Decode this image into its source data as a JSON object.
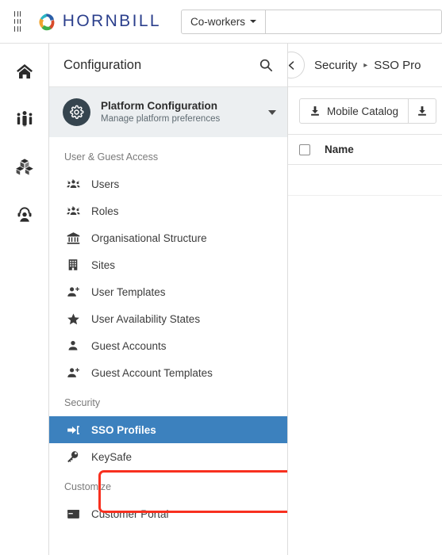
{
  "topbar": {
    "apps_icon": "apps-grid-icon",
    "brand_name": "HORNBILL",
    "brand_logo_icon": "hornbill-pinwheel-logo",
    "search_scope_label": "Co-workers",
    "search_placeholder": "",
    "search_value": "",
    "caret_icon": "caret-down-icon"
  },
  "rail": {
    "items": [
      {
        "icon": "home-icon",
        "name": "home"
      },
      {
        "icon": "people-group-icon",
        "name": "collaboration"
      },
      {
        "icon": "boxes-icon",
        "name": "applications"
      },
      {
        "icon": "service-agent-icon",
        "name": "service-manager"
      }
    ]
  },
  "config_panel": {
    "title": "Configuration",
    "search_icon": "search-icon",
    "context": {
      "icon": "gear-icon",
      "title": "Platform Configuration",
      "subtitle": "Manage platform preferences",
      "caret_icon": "caret-down-icon"
    },
    "groups": [
      {
        "label": "User & Guest Access",
        "items": [
          {
            "label": "Users",
            "icon": "users-group-icon",
            "active": false
          },
          {
            "label": "Roles",
            "icon": "users-group-icon",
            "active": false
          },
          {
            "label": "Organisational Structure",
            "icon": "institution-icon",
            "active": false
          },
          {
            "label": "Sites",
            "icon": "building-icon",
            "active": false
          },
          {
            "label": "User Templates",
            "icon": "user-plus-icon",
            "active": false
          },
          {
            "label": "User Availability States",
            "icon": "star-icon",
            "active": false
          },
          {
            "label": "Guest Accounts",
            "icon": "user-icon",
            "active": false
          },
          {
            "label": "Guest Account Templates",
            "icon": "user-plus-icon",
            "active": false
          }
        ]
      },
      {
        "label": "Security",
        "items": [
          {
            "label": "SSO Profiles",
            "icon": "sign-in-icon",
            "active": true
          },
          {
            "label": "KeySafe",
            "icon": "key-icon",
            "active": false
          }
        ]
      },
      {
        "label": "Customize",
        "items": [
          {
            "label": "Customer Portal",
            "icon": "window-icon",
            "active": false
          }
        ]
      }
    ]
  },
  "annotation": {
    "target": "SSO Profiles",
    "color": "#f8301f"
  },
  "content": {
    "back_icon": "chevron-left-icon",
    "breadcrumb": [
      "Security",
      "SSO Pro"
    ],
    "breadcrumb_separator": "▸",
    "toolbar": {
      "buttons": [
        {
          "label": "Mobile Catalog",
          "icon": "download-icon"
        },
        {
          "label": "",
          "icon": "download-icon"
        }
      ]
    },
    "table": {
      "select_all_checkbox": "unchecked",
      "columns": [
        "Name"
      ],
      "rows": []
    }
  },
  "colors": {
    "accent_blue": "#3c81be",
    "brand_blue": "#2b3f8c",
    "annotation_red": "#f8301f",
    "context_bg": "#eceff1",
    "avatar_bg": "#36454f"
  }
}
